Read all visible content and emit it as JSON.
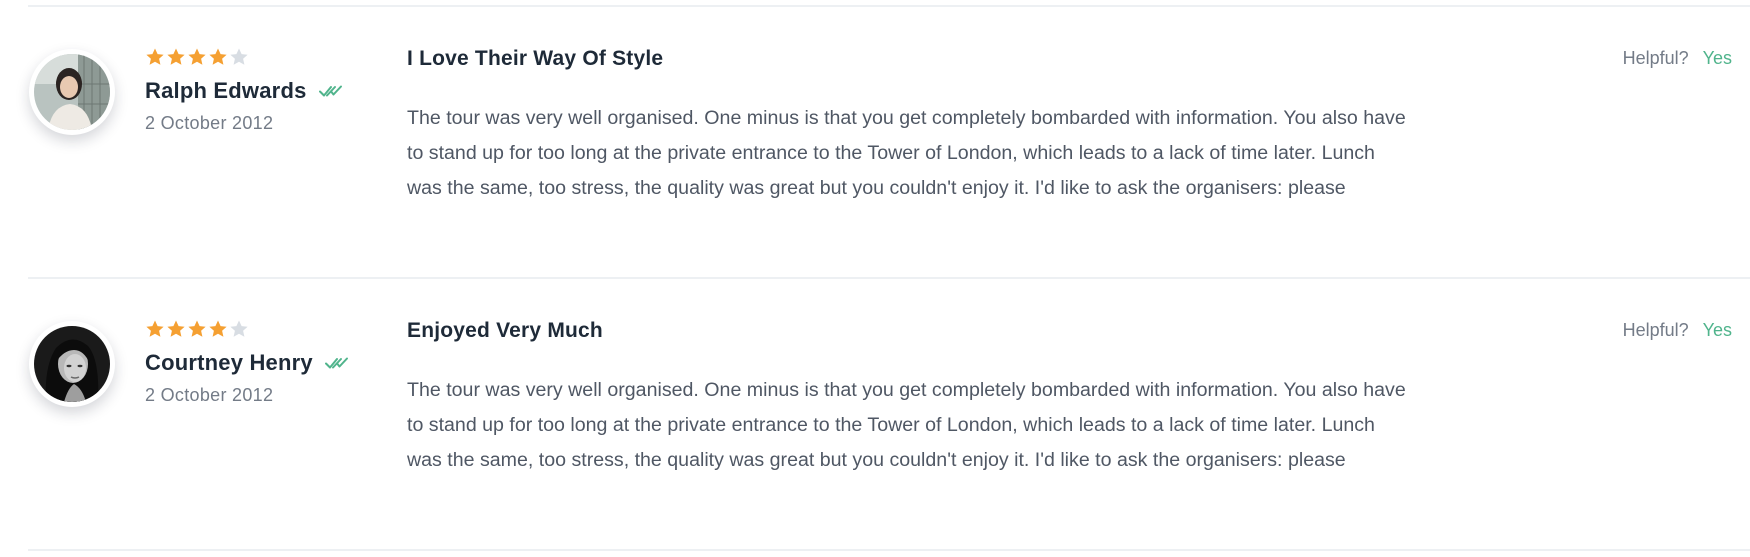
{
  "colors": {
    "star_filled": "#f5a032",
    "star_empty": "#d8dde3",
    "verified": "#50b48c",
    "yes_link": "#50b48c",
    "text_dark": "#1e2a38",
    "text_muted": "#737b87"
  },
  "reviews": [
    {
      "rating": 4,
      "rating_max": 5,
      "author": "Ralph Edwards",
      "verified_icon": "double-check-icon",
      "date": "2 October 2012",
      "title": "I Love Their Way Of Style",
      "body": "The tour was very well organised. One minus is that you get completely bombarded with information. You also have to stand up for too long at the private entrance to the Tower of London, which leads to a lack of time later. Lunch was the same, too stress, the quality was great but you couldn't enjoy it. I'd like to ask the organisers: please",
      "helpful_label": "Helpful?",
      "helpful_yes": "Yes"
    },
    {
      "rating": 4,
      "rating_max": 5,
      "author": "Courtney Henry",
      "verified_icon": "double-check-icon",
      "date": "2 October 2012",
      "title": "Enjoyed Very Much",
      "body": "The tour was very well organised. One minus is that you get completely bombarded with information. You also have to stand up for too long at the private entrance to the Tower of London, which leads to a lack of time later. Lunch was the same, too stress, the quality was great but you couldn't enjoy it. I'd like to ask the organisers: please",
      "helpful_label": "Helpful?",
      "helpful_yes": "Yes"
    }
  ]
}
